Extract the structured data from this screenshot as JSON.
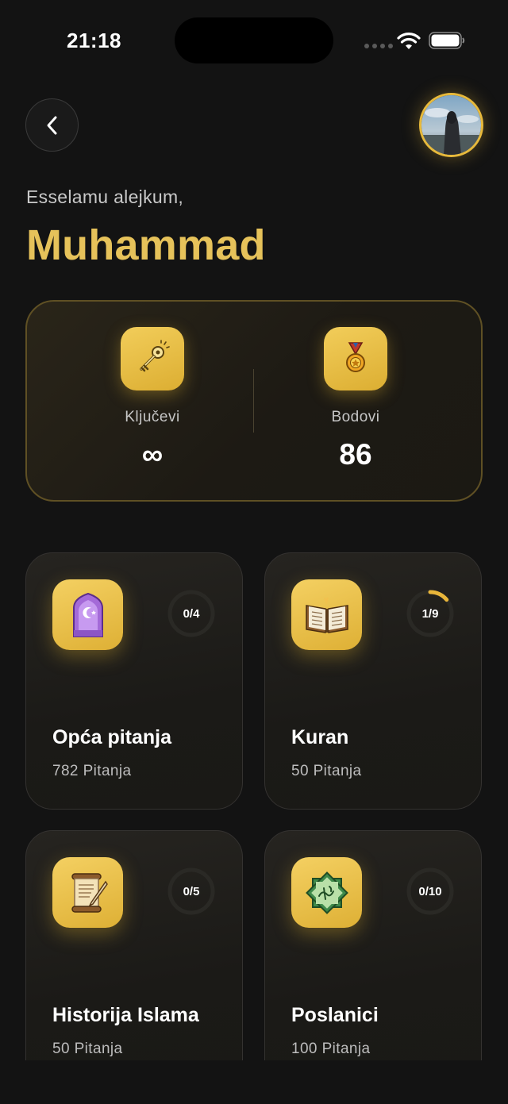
{
  "status_bar": {
    "time": "21:18"
  },
  "header": {
    "greeting": "Esselamu alejkum,",
    "username": "Muhammad"
  },
  "stats": {
    "keys": {
      "label": "Ključevi",
      "value": "∞"
    },
    "points": {
      "label": "Bodovi",
      "value": "86"
    }
  },
  "categories": [
    {
      "title": "Opća pitanja",
      "subtitle": "782 Pitanja",
      "progress_text": "0/4",
      "progress": 0.0,
      "icon": "mosque-icon"
    },
    {
      "title": "Kuran",
      "subtitle": "50 Pitanja",
      "progress_text": "1/9",
      "progress": 0.111,
      "icon": "open-book-icon"
    },
    {
      "title": "Historija Islama",
      "subtitle": "50 Pitanja",
      "progress_text": "0/5",
      "progress": 0.0,
      "icon": "scroll-icon"
    },
    {
      "title": "Poslanici",
      "subtitle": "100 Pitanja",
      "progress_text": "0/10",
      "progress": 0.0,
      "icon": "calligraphy-star-icon"
    }
  ],
  "colors": {
    "background": "#131313",
    "accent_gold": "#e6c25a",
    "tile_gold": "#f2cd5a",
    "progress_arc": "#e8b53a"
  }
}
